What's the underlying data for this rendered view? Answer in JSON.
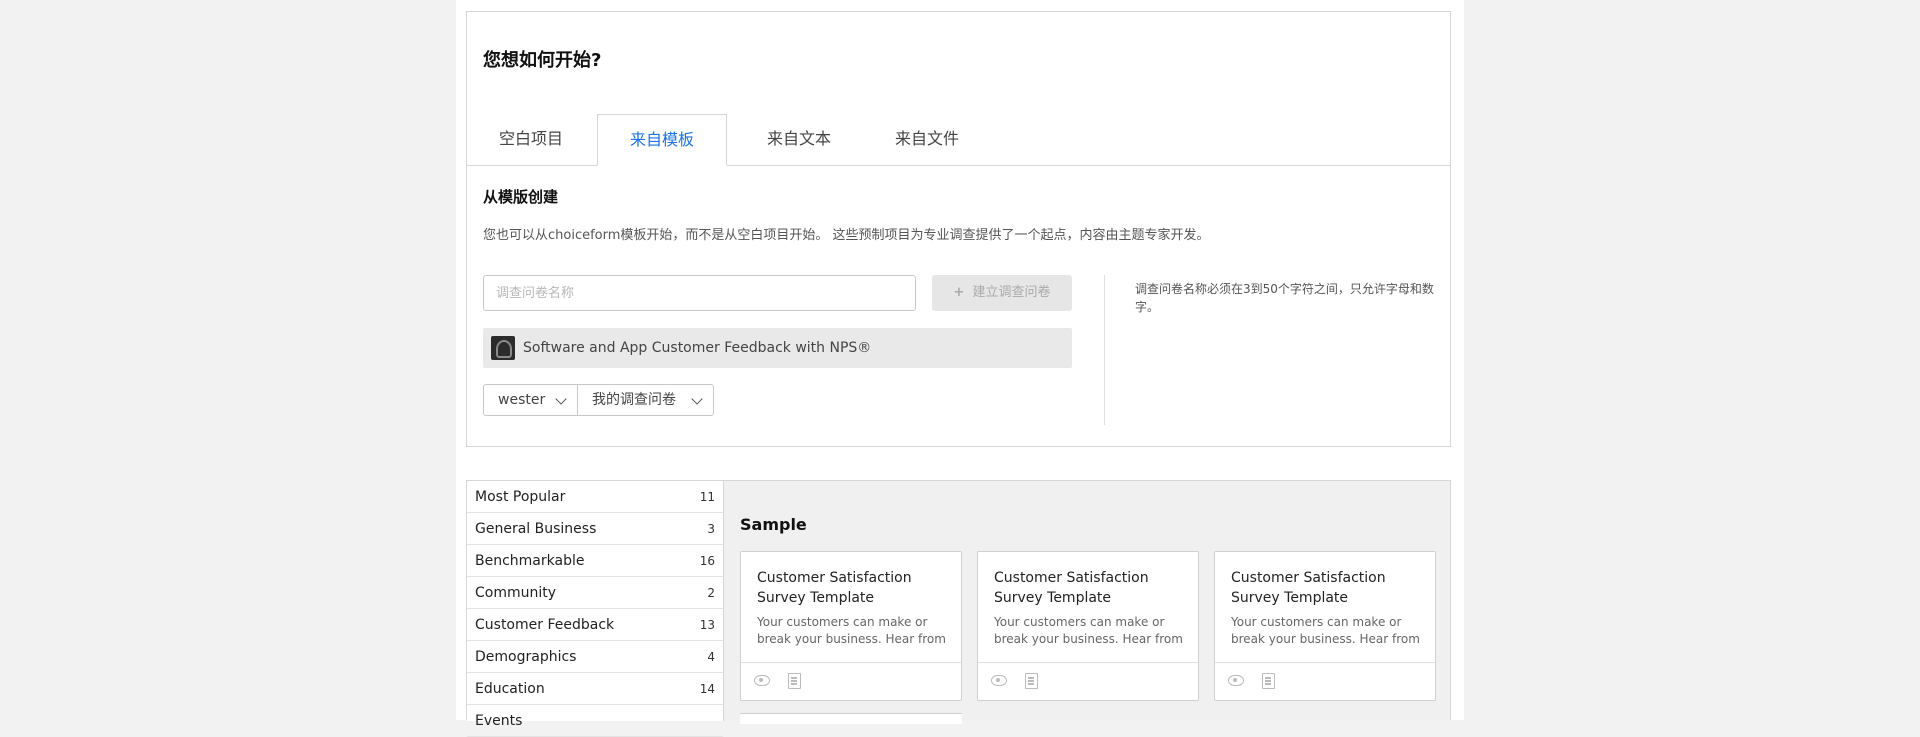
{
  "header": {
    "title": "您想如何开始?"
  },
  "tabs": [
    {
      "label": "空白项目",
      "active": false
    },
    {
      "label": "来自模板",
      "active": true
    },
    {
      "label": "来自文本",
      "active": false
    },
    {
      "label": "来自文件",
      "active": false
    }
  ],
  "section": {
    "title": "从模版创建",
    "description": "您也可以从choiceform模板开始，而不是从空白项目开始。 这些预制项目为专业调查提供了一个起点，内容由主题专家开发。"
  },
  "form": {
    "name_placeholder": "调查问卷名称",
    "name_value": "",
    "create_label": "建立调查问卷",
    "selected_template": "Software and App Customer Feedback with NPS®",
    "user_select": "wester",
    "folder_select": "我的调查问卷",
    "hint": "调查问卷名称必须在3到50个字符之间，只允许字母和数字。"
  },
  "categories": [
    {
      "label": "Most Popular",
      "count": "11"
    },
    {
      "label": "General Business",
      "count": "3"
    },
    {
      "label": "Benchmarkable",
      "count": "16"
    },
    {
      "label": "Community",
      "count": "2"
    },
    {
      "label": "Customer Feedback",
      "count": "13"
    },
    {
      "label": "Demographics",
      "count": "4"
    },
    {
      "label": "Education",
      "count": "14"
    },
    {
      "label": "Events",
      "count": ""
    }
  ],
  "sample": {
    "title": "Sample",
    "cards": [
      {
        "title": "Customer Satisfaction Survey Template",
        "description": "Your customers can make or break your business. Hear from them directly."
      },
      {
        "title": "Customer Satisfaction Survey Template",
        "description": "Your customers can make or break your business. Hear from them directly."
      },
      {
        "title": "Customer Satisfaction Survey Template",
        "description": "Your customers can make or break your business. Hear from them directly."
      }
    ]
  },
  "icons": {
    "create": "plus-icon",
    "chevron": "chevron-down-icon",
    "preview": "eye-icon",
    "details": "document-icon"
  },
  "colors": {
    "accent": "#1a73e8",
    "border": "#d6d6d6",
    "disabled_bg": "#e6e6e6"
  }
}
